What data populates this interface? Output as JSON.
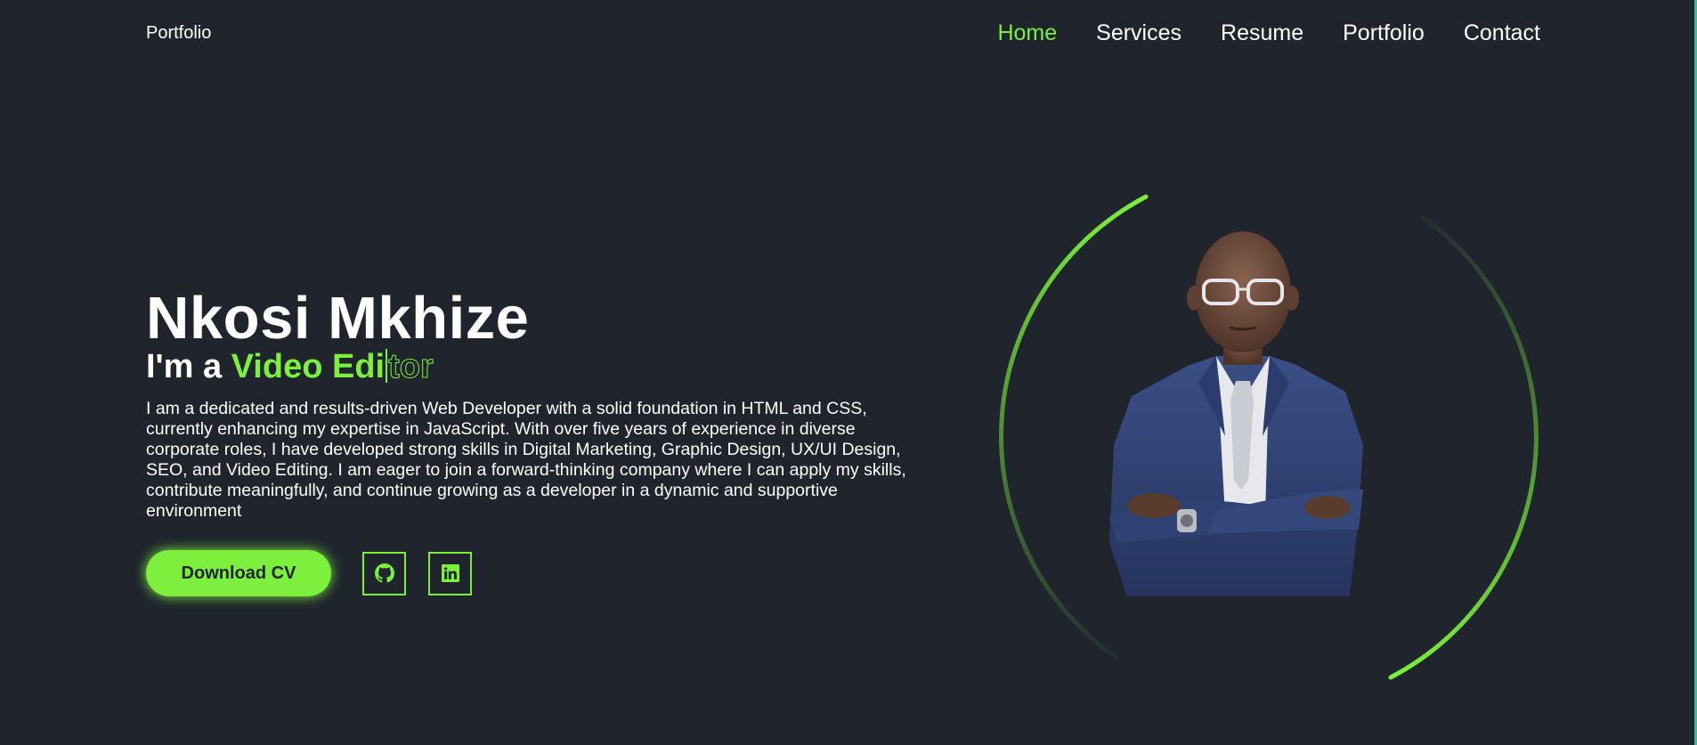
{
  "header": {
    "logo": "Portfolio",
    "nav": [
      {
        "label": "Home",
        "active": true
      },
      {
        "label": "Services",
        "active": false
      },
      {
        "label": "Resume",
        "active": false
      },
      {
        "label": "Portfolio",
        "active": false
      },
      {
        "label": "Contact",
        "active": false
      }
    ]
  },
  "hero": {
    "name": "Nkosi Mkhize",
    "role_prefix": "I'm a ",
    "role_typed": "Video Edi",
    "role_ghost": "tor",
    "description": "I am a dedicated and results-driven Web Developer with a solid foundation in HTML and CSS, currently enhancing my expertise in JavaScript. With over five years of experience in diverse corporate roles, I have developed strong skills in Digital Marketing, Graphic Design, UX/UI Design, SEO, and Video Editing. I am eager to join a forward-thinking company where I can apply my skills, contribute meaningfully, and continue growing as a developer in a dynamic and supportive environment",
    "download_label": "Download CV",
    "social": [
      {
        "icon": "github-icon"
      },
      {
        "icon": "linkedin-icon"
      }
    ]
  },
  "colors": {
    "background": "#1f242d",
    "accent": "#7cf03d",
    "text": "#ffffff"
  }
}
